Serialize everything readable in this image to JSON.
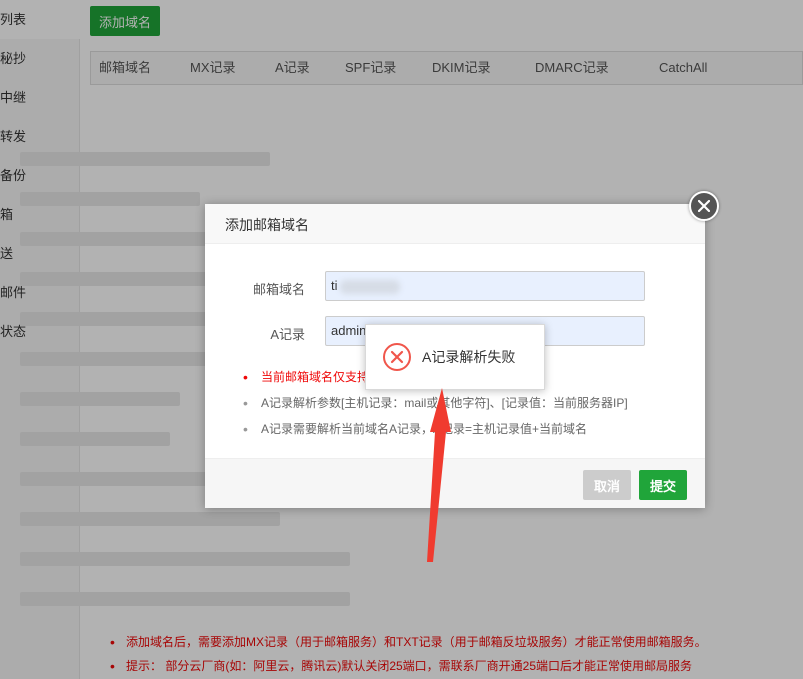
{
  "sidebar": {
    "items": [
      {
        "label": "列表"
      },
      {
        "label": "秘抄"
      },
      {
        "label": "中继"
      },
      {
        "label": "转发"
      },
      {
        "label": "备份"
      },
      {
        "label": "箱"
      },
      {
        "label": "送"
      },
      {
        "label": "邮件"
      },
      {
        "label": "状态"
      }
    ]
  },
  "toolbar": {
    "add_domain_label": "添加域名"
  },
  "table": {
    "columns": [
      "邮箱域名",
      "MX记录",
      "A记录",
      "SPF记录",
      "DKIM记录",
      "DMARC记录",
      "CatchAll"
    ]
  },
  "footer_notes": [
    "添加域名后，需要添加MX记录（用于邮箱服务）和TXT记录（用于邮箱反垃圾服务）才能正常使用邮箱服务。",
    "提示：  部分云厂商(如：阿里云，腾讯云)默认关闭25端口，需联系厂商开通25端口后才能正常使用邮局服务"
  ],
  "dialog": {
    "title": "添加邮箱域名",
    "fields": {
      "domain": {
        "label": "邮箱域名",
        "value": "ti"
      },
      "a_record": {
        "label": "A记录",
        "value": "admin"
      }
    },
    "help": [
      "当前邮箱域名仅支持",
      "A记录解析参数[主机记录：mail或其他字符]、[记录值：当前服务器IP]",
      "A记录需要解析当前域名A记录，A记录=主机记录值+当前域名"
    ],
    "cancel_label": "取消",
    "submit_label": "提交"
  },
  "toast": {
    "message": "A记录解析失败",
    "icon": "error-x-icon"
  },
  "colors": {
    "accent_green": "#20a53a",
    "error_red": "#ef0808",
    "annotation_red": "#f03b2f"
  }
}
